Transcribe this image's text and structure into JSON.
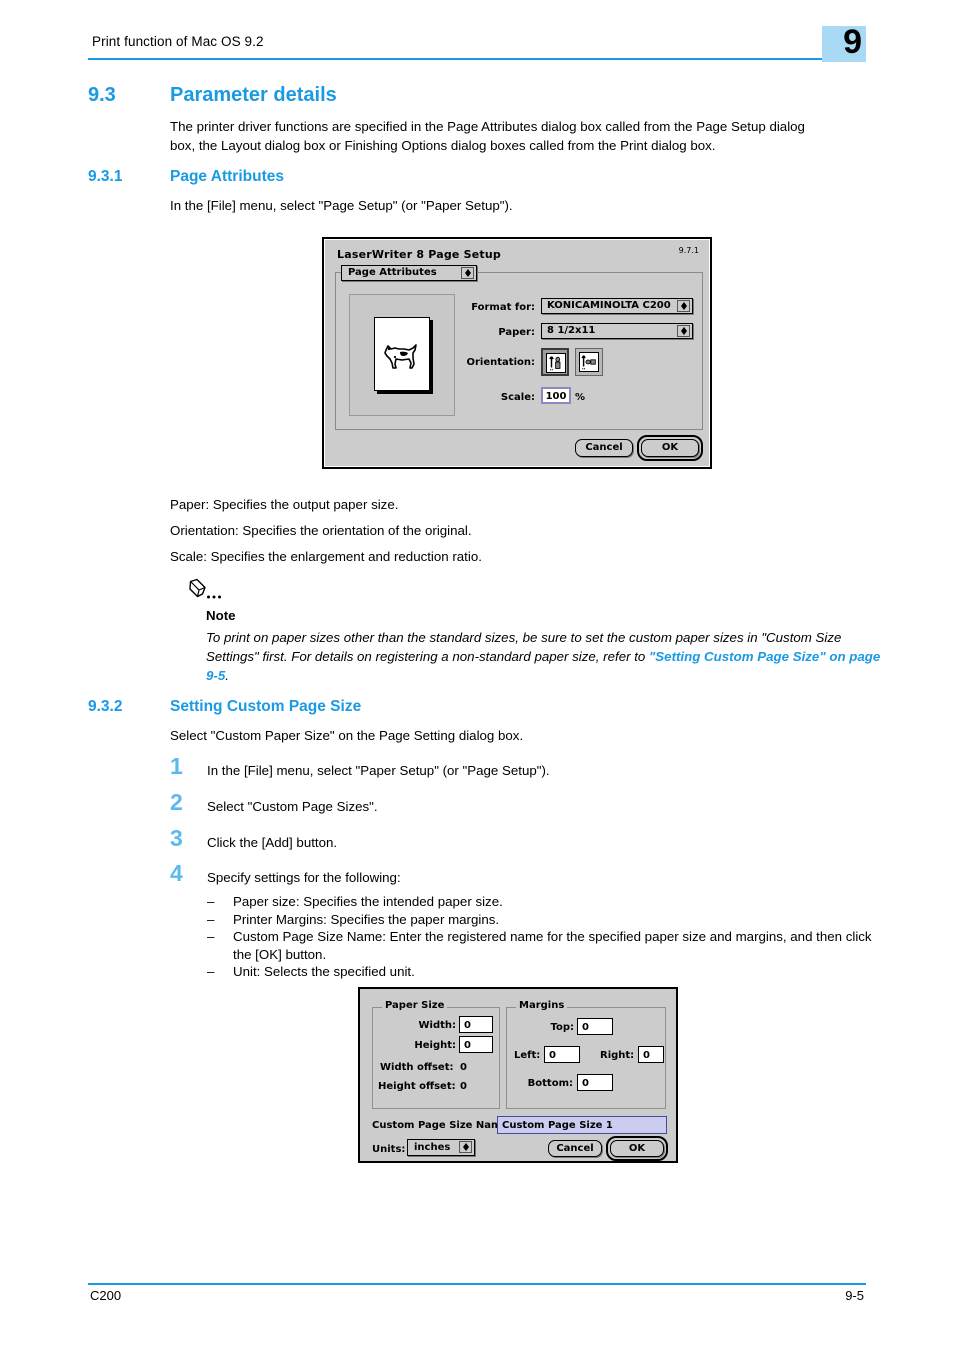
{
  "header": {
    "running_title": "Print function of Mac OS 9.2",
    "chapter_number": "9",
    "rule_color": "#1a9ae5",
    "badge_color": "#a8daf5"
  },
  "sections": {
    "s93": {
      "number": "9.3",
      "title": "Parameter details",
      "intro_line1": "The printer driver functions are specified in the Page Attributes dialog box called from the Page Setup dialog",
      "intro_line2": "box, the Layout dialog box or Finishing Options dialog boxes called from the Print dialog box."
    },
    "s931": {
      "number": "9.3.1",
      "title": "Page Attributes",
      "intro": "In the [File] menu, select \"Page Setup\" (or \"Paper Setup\")."
    },
    "s932": {
      "number": "9.3.2",
      "title": "Setting Custom Page Size",
      "intro": "Select \"Custom Paper Size\" on the Page Setting dialog box."
    }
  },
  "descriptions": {
    "paper": "Paper: Specifies the output paper size.",
    "orientation": "Orientation: Specifies the orientation of the original.",
    "scale": "Scale: Specifies the enlargement and reduction ratio."
  },
  "note": {
    "label": "Note",
    "body_part1": "To print on paper sizes other than the standard sizes, be sure to set the custom paper sizes in \"Custom Size Settings\" first. For details on registering a non-standard paper size, refer to ",
    "link_text": "\"Setting Custom Page Size\" on page 9-5",
    "body_part2": ".",
    "link_color": "#1a9ae5"
  },
  "steps": [
    {
      "number": "1",
      "text": "In the [File] menu, select \"Paper Setup\" (or \"Page Setup\")."
    },
    {
      "number": "2",
      "text": "Select \"Custom Page Sizes\"."
    },
    {
      "number": "3",
      "text": "Click the [Add] button."
    },
    {
      "number": "4",
      "text": "Specify settings for the following:"
    }
  ],
  "sub_items": [
    {
      "dash": "–",
      "text": "Paper size: Specifies the intended paper size."
    },
    {
      "dash": "–",
      "text": "Printer Margins: Specifies the paper margins."
    },
    {
      "dash": "–",
      "text": "Custom Page Size Name: Enter the registered name for the specified paper size and margins, and then click the [OK] button."
    },
    {
      "dash": "–",
      "text": "Unit: Selects the specified unit."
    }
  ],
  "dialog_page_setup": {
    "title": "LaserWriter 8 Page Setup",
    "version": "9.7.1",
    "pane_popup": "Page Attributes",
    "format_for_label": "Format for:",
    "format_for_value": "KONICAMINOLTA C200",
    "paper_label": "Paper:",
    "paper_value": "8 1/2x11",
    "orientation_label": "Orientation:",
    "orientation_selected": "portrait",
    "orientation_options": [
      "portrait-icon",
      "landscape-icon"
    ],
    "scale_label": "Scale:",
    "scale_value": "100",
    "scale_unit": "%",
    "cancel_label": "Cancel",
    "ok_label": "OK"
  },
  "dialog_custom_page_size": {
    "paper_size_group": "Paper Size",
    "width_label": "Width:",
    "width_value": "0",
    "height_label": "Height:",
    "height_value": "0",
    "width_offset_label": "Width offset:",
    "width_offset_value": "0",
    "height_offset_label": "Height offset:",
    "height_offset_value": "0",
    "margins_group": "Margins",
    "top_label": "Top:",
    "top_value": "0",
    "left_label": "Left:",
    "left_value": "0",
    "right_label": "Right:",
    "right_value": "0",
    "bottom_label": "Bottom:",
    "bottom_value": "0",
    "name_label": "Custom Page Size Name:",
    "name_value": "Custom Page Size 1",
    "units_label": "Units:",
    "units_value": "inches",
    "cancel_label": "Cancel",
    "ok_label": "OK"
  },
  "footer": {
    "product": "C200",
    "page_number": "9-5"
  }
}
